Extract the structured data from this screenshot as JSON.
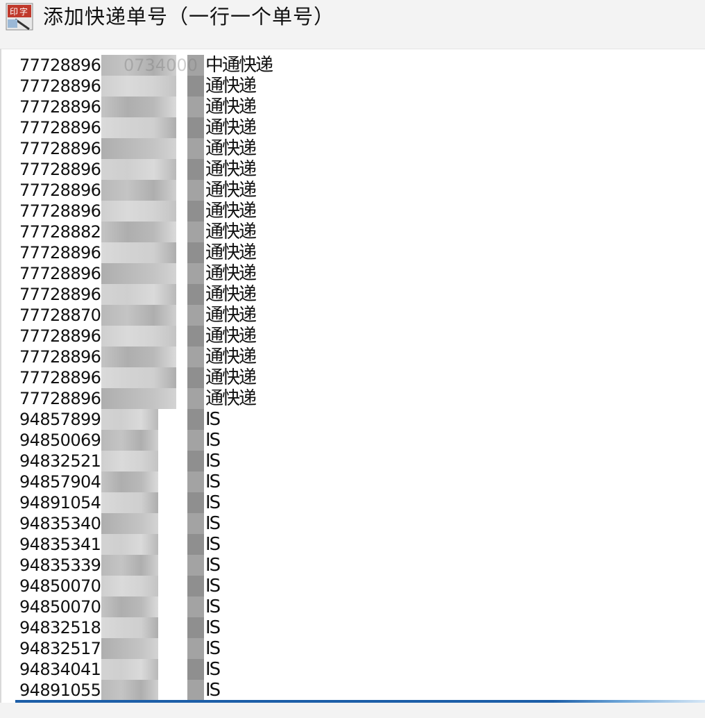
{
  "window": {
    "title": "添加快递单号（一行一个单号）",
    "icon": "app-icon"
  },
  "editor": {
    "lines": [
      {
        "prefix": "77728896",
        "suffix": "中通快递",
        "visible_tail": "0734000"
      },
      {
        "prefix": "77728896",
        "suffix": "通快递"
      },
      {
        "prefix": "77728896",
        "suffix": "通快递"
      },
      {
        "prefix": "77728896",
        "suffix": "通快递"
      },
      {
        "prefix": "77728896",
        "suffix": "通快递"
      },
      {
        "prefix": "77728896",
        "suffix": "通快递"
      },
      {
        "prefix": "77728896",
        "suffix": "通快递"
      },
      {
        "prefix": "77728896",
        "suffix": "通快递"
      },
      {
        "prefix": "77728882",
        "suffix": "通快递"
      },
      {
        "prefix": "77728896",
        "suffix": "通快递"
      },
      {
        "prefix": "77728896",
        "suffix": "通快递"
      },
      {
        "prefix": "77728896",
        "suffix": "通快递"
      },
      {
        "prefix": "77728870",
        "suffix": "通快递"
      },
      {
        "prefix": "77728896",
        "suffix": "通快递"
      },
      {
        "prefix": "77728896",
        "suffix": "通快递"
      },
      {
        "prefix": "77728896",
        "suffix": "通快递"
      },
      {
        "prefix": "77728896",
        "suffix": "通快递"
      },
      {
        "prefix": "94857899",
        "suffix": "IS"
      },
      {
        "prefix": "94850069",
        "suffix": "IS"
      },
      {
        "prefix": "94832521",
        "suffix": "IS"
      },
      {
        "prefix": "94857904",
        "suffix": "IS"
      },
      {
        "prefix": "94891054",
        "suffix": "IS"
      },
      {
        "prefix": "94835340",
        "suffix": "IS"
      },
      {
        "prefix": "94835341",
        "suffix": "IS"
      },
      {
        "prefix": "94835339",
        "suffix": "IS"
      },
      {
        "prefix": "94850070",
        "suffix": "IS"
      },
      {
        "prefix": "94850070",
        "suffix": "IS"
      },
      {
        "prefix": "94832518",
        "suffix": "IS"
      },
      {
        "prefix": "94832517",
        "suffix": "IS"
      },
      {
        "prefix": "94834041",
        "suffix": "IS"
      },
      {
        "prefix": "94891055",
        "suffix": "IS"
      }
    ]
  }
}
